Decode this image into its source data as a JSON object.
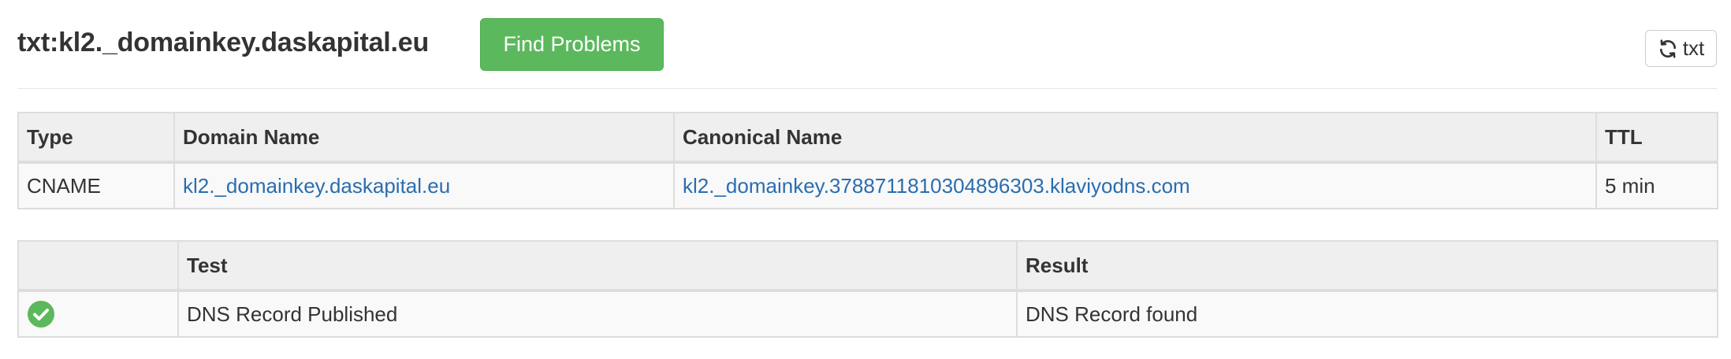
{
  "header": {
    "title": "txt:kl2._domainkey.daskapital.eu",
    "find_problems_label": "Find Problems",
    "refresh_label": "txt",
    "refresh_icon": "refresh-icon",
    "find_problems_color": "#5cb85c"
  },
  "records": {
    "columns": [
      "Type",
      "Domain Name",
      "Canonical Name",
      "TTL"
    ],
    "rows": [
      {
        "type": "CNAME",
        "domain_name": "kl2._domainkey.daskapital.eu",
        "canonical_name": "kl2._domainkey.3788711810304896303.klaviyodns.com",
        "ttl": "5 min"
      }
    ]
  },
  "tests": {
    "columns": [
      "",
      "Test",
      "Result"
    ],
    "rows": [
      {
        "status_icon": "check-circle-icon",
        "status_color": "#5cb85c",
        "test": "DNS Record Published",
        "result": "DNS Record found"
      }
    ]
  },
  "colors": {
    "link": "#2a6db0",
    "header_bg": "#efefef",
    "row_bg": "#f9f9f9",
    "border": "#dddddd"
  }
}
